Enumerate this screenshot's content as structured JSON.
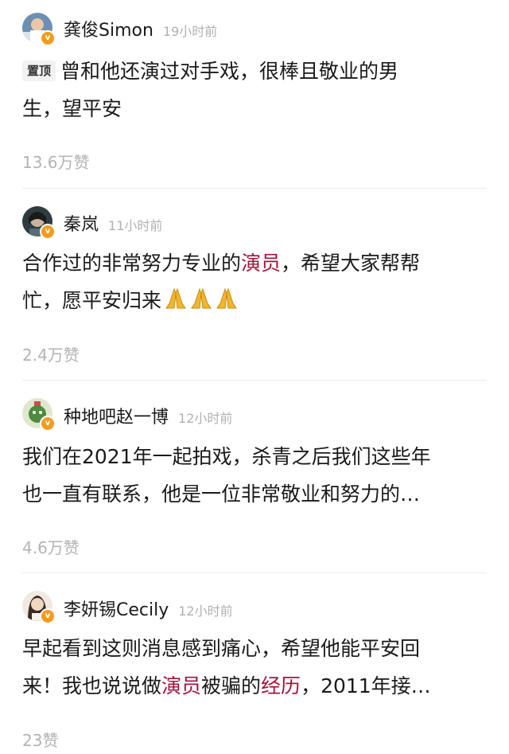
{
  "comments": [
    {
      "name": "龚俊Simon",
      "time": "19小时前",
      "badge": "置顶",
      "line1": "曾和他还演过对手戏，很棒且敬业的男",
      "line2": "生，望平安",
      "likes": "13.6万赞"
    },
    {
      "name": "秦岚",
      "time": "11小时前",
      "line1_pre": "合作过的非常努力专业的",
      "line1_hl": "演员",
      "line1_post": "，希望大家帮帮",
      "line2": "忙，愿平安归来",
      "emoji": "praying-hands x3",
      "likes": "2.4万赞"
    },
    {
      "name": "种地吧赵一博",
      "time": "12小时前",
      "line1": "我们在2021年一起拍戏，杀青之后我们这些年",
      "line2": "也一直有联系，他是一位非常敬业和努力的…",
      "likes": "4.6万赞"
    },
    {
      "name": "李妍锡Cecily",
      "time": "12小时前",
      "line1": "早起看到这则消息感到痛心，希望他能平安回",
      "line2_a": "来！我也说说做",
      "line2_hl1": "演员",
      "line2_b": "被骗的",
      "line2_hl2": "经历",
      "line2_c": "，2011年接…",
      "likes": "23赞"
    }
  ],
  "colors": {
    "highlight": "#a0173b",
    "verified": "#f29c1f",
    "muted": "#b0b0b0"
  }
}
